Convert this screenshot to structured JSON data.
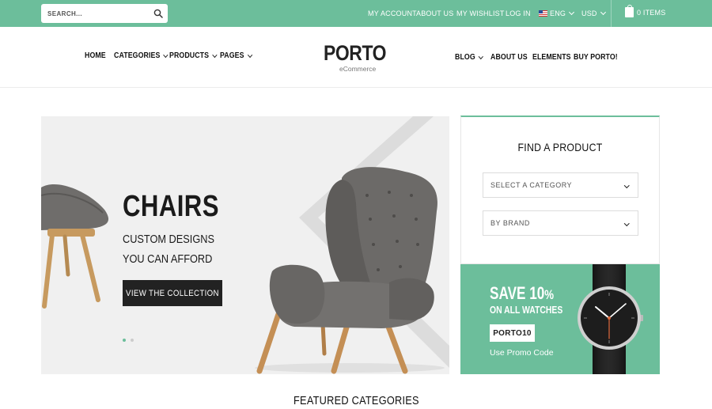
{
  "topbar": {
    "search_placeholder": "SEARCH...",
    "links": {
      "my_account": "MY ACCOUNT",
      "about_us": "ABOUT US",
      "my_wishlist": "MY WISHLIST",
      "log_in": "LOG IN"
    },
    "language": "ENG",
    "currency": "USD",
    "cart_label": "0 ITEMS"
  },
  "header": {
    "logo": "PORTO",
    "logo_sub": "eCommerce",
    "nav_left": [
      "HOME",
      "CATEGORIES",
      "PRODUCTS",
      "PAGES"
    ],
    "nav_right": [
      "BLOG",
      "ABOUT US",
      "ELEMENTS",
      "BUY PORTO!"
    ]
  },
  "hero": {
    "title": "CHAIRS",
    "subtitle_line1": "CUSTOM DESIGNS",
    "subtitle_line2": "YOU CAN AFFORD",
    "button": "VIEW THE COLLECTION",
    "slides": 2,
    "active_slide": 1
  },
  "finder": {
    "title": "FIND A PRODUCT",
    "category_select": "SELECT A CATEGORY",
    "brand_select": "BY BRAND"
  },
  "promo": {
    "save": "SAVE 10",
    "percent": "%",
    "line2": "ON ALL WATCHES",
    "code": "PORTO10",
    "note": "Use Promo Code"
  },
  "featured_title": "FEATURED CATEGORIES",
  "colors": {
    "accent": "#6cbe9b",
    "dark": "#222222",
    "hero_bg": "#f0f0f0"
  }
}
